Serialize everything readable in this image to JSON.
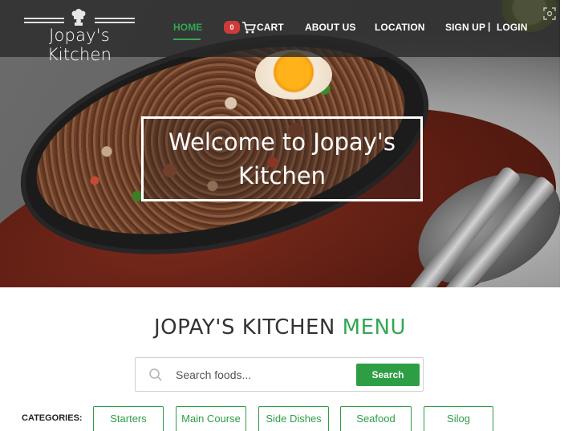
{
  "brand": {
    "name": "Jopay's Kitchen"
  },
  "nav": {
    "home": "HOME",
    "cart_count": "0",
    "cart": "CART",
    "about": "ABOUT US",
    "location": "LOCATION",
    "signup": "SIGN UP",
    "separator": "|",
    "login": "LOGIN"
  },
  "hero": {
    "welcome": "Welcome to Jopay's Kitchen"
  },
  "menu": {
    "title_main": "JOPAY'S KITCHEN",
    "title_accent": "MENU",
    "search_placeholder": "Search foods...",
    "search_button": "Search",
    "categories_label": "CATEGORIES:",
    "categories": [
      "Starters",
      "Main Course",
      "Side Dishes",
      "Seafood",
      "Silog"
    ]
  },
  "colors": {
    "accent": "#32a852",
    "badge": "#d03a3a",
    "nav_bg": "#282828"
  },
  "icons": {
    "chef": "chef-hat-icon",
    "cart": "cart-icon",
    "search": "search-icon",
    "corner": "screen-capture-icon"
  }
}
